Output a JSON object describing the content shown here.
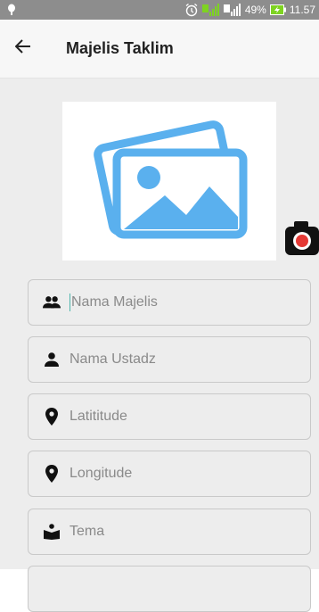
{
  "status_bar": {
    "battery_percent": "49%",
    "time": "11.57",
    "icons": [
      "notification-icon",
      "alarm-icon",
      "signal-icon",
      "signal-icon",
      "battery-icon"
    ]
  },
  "app_bar": {
    "title": "Majelis Taklim",
    "back_icon": "arrow-back-icon"
  },
  "form": {
    "image_icon": "image-placeholder-icon",
    "camera_icon": "camera-icon",
    "fields": [
      {
        "placeholder": "Nama Majelis",
        "icon": "group-icon"
      },
      {
        "placeholder": "Nama Ustadz",
        "icon": "person-icon"
      },
      {
        "placeholder": "Latititude",
        "icon": "location-pin-icon"
      },
      {
        "placeholder": "Longitude",
        "icon": "location-pin-icon"
      },
      {
        "placeholder": "Tema",
        "icon": "book-reader-icon"
      },
      {
        "placeholder": "",
        "icon": ""
      }
    ]
  },
  "colors": {
    "image_accent": "#5ab0ee",
    "camera_record": "#e53935",
    "status_bar": "#8d8d8d",
    "cursor": "#4db6ac"
  }
}
